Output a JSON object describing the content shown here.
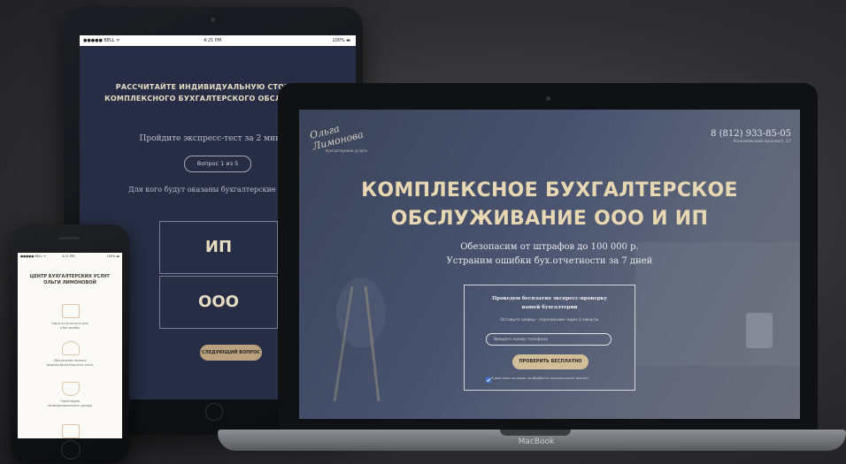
{
  "tablet": {
    "status": {
      "carrier": "●●●●● BELL ᯤ",
      "time": "4:21 PM",
      "battery": "100% ▬"
    },
    "headline_line1": "РАССЧИТАЙТЕ ИНДИВИДУАЛЬНУЮ СТОИМОСТЬ",
    "headline_line2": "КОМПЛЕКСНОГО БУХГАЛТЕРСКОГО ОБСЛУЖИВАНИЯ",
    "intro": "Пройдите экспресс-тест за 2 минуты",
    "step": "Вопрос 1 из 5",
    "question": "Для кого будут оказаны бухгалтерские услуги?",
    "option1": "ИП",
    "option2": "ООО",
    "next_button": "СЛЕДУЮЩИЙ ВОПРОС"
  },
  "laptop": {
    "logo_text": "Ольга Лимонова",
    "logo_subtitle": "бухгалтерские услуги",
    "phone": "8 (812) 933-85-05",
    "address": "Коломяжский проспект, 27",
    "title_line1": "КОМПЛЕКСНОЕ БУХГАЛТЕРСКОЕ",
    "title_line2": "ОБСЛУЖИВАНИЕ ООО И ИП",
    "subtitle_line1": "Обезопасим от штрафов до 100 000 р.",
    "subtitle_line2": "Устраним ошибки бух.отчетности за 7 дней",
    "form": {
      "title_line1": "Проведем бесплатно экспресс-проверку",
      "title_line2": "вашей бухгалтерии",
      "note": "Оставьте заявку - перезвоним через 2 минуты",
      "phone_placeholder": "Введите номер телефона",
      "submit": "ПРОВЕРИТЬ БЕСПЛАТНО",
      "consent": "Я даю свое согласие на обработку персональных данных"
    },
    "brand": "MacBook"
  },
  "phone": {
    "status": {
      "carrier": "●●●●● BELL ᯤ",
      "time": "4:21 PM",
      "battery": "100% ▬"
    },
    "title_line1": "ЦЕНТР БУХГАЛТЕРСКИХ УСЛУГ",
    "title_line2": "ОЛЬГИ ЛИМОНОВОЙ",
    "items": [
      {
        "caption_line1": "Сдача отчетности в срок",
        "caption_line2": "и без ошибок",
        "icon": "calendar-icon"
      },
      {
        "caption_line1": "Обеспечение полного",
        "caption_line2": "ведения бухгалтерского учета",
        "icon": "person-icon"
      },
      {
        "caption_line1": "Гарантируем",
        "caption_line2": "конфиденциальность данных",
        "icon": "shield-icon"
      },
      {
        "caption_line1": "",
        "caption_line2": "",
        "icon": "checkbox-icon"
      }
    ]
  },
  "colors": {
    "accent": "#d2bd99",
    "screen_dark": "#262d44",
    "title_gold": "#e8d7b3"
  }
}
